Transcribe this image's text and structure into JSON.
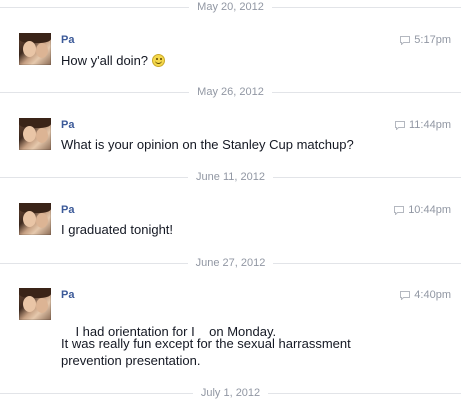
{
  "dividers": [
    "May 20, 2012",
    "May 26, 2012",
    "June 11, 2012",
    "June 27, 2012",
    "July 1, 2012"
  ],
  "messages": [
    {
      "sender": "Pa",
      "time": "5:17pm",
      "lines": [
        "How y'all doin?"
      ],
      "emoji": "smiley-icon"
    },
    {
      "sender": "Pa",
      "time": "11:44pm",
      "lines": [
        "What is your opinion on the Stanley Cup matchup?"
      ]
    },
    {
      "sender": "Pa",
      "time": "10:44pm",
      "lines": [
        "I graduated tonight!"
      ]
    },
    {
      "sender": "Pa",
      "time": "4:40pm",
      "lines": [
        "I had orientation for I    on Monday.",
        "It was really fun except for the sexual harrassment prevention presentation."
      ]
    }
  ],
  "colors": {
    "name": "#3b5998",
    "meta": "#9197a3",
    "text": "#141823",
    "line": "#e2e4e8"
  },
  "icons": {
    "message_source": "chat-bubble-icon"
  }
}
